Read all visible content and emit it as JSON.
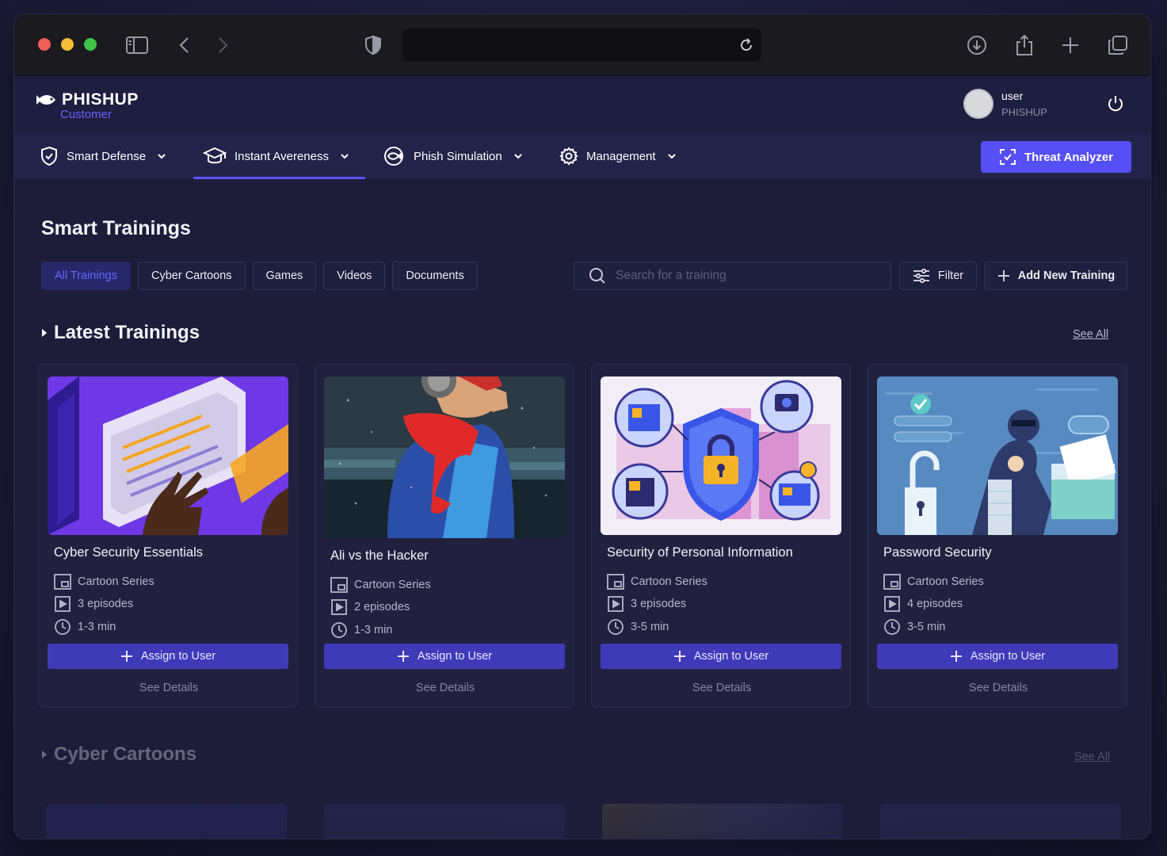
{
  "app": {
    "brand": "PHISHUP",
    "subtitle": "Customer"
  },
  "user": {
    "name": "user",
    "org": "PHISHUP"
  },
  "nav": {
    "items": [
      {
        "label": "Smart Defense",
        "icon": "shield-check-icon"
      },
      {
        "label": "Instant Avereness",
        "icon": "graduation-cap-icon",
        "active": true
      },
      {
        "label": "Phish Simulation",
        "icon": "fish-target-icon"
      },
      {
        "label": "Management",
        "icon": "gear-icon"
      }
    ],
    "threat_button": "Threat Analyzer"
  },
  "page": {
    "title": "Smart Trainings",
    "tabs": [
      {
        "label": "All Trainings",
        "active": true
      },
      {
        "label": "Cyber Cartoons"
      },
      {
        "label": "Games"
      },
      {
        "label": "Videos"
      },
      {
        "label": "Documents"
      }
    ],
    "search_placeholder": "Search for a training",
    "filter_label": "Filter",
    "add_label": "Add New Training"
  },
  "sections": [
    {
      "title": "Latest Trainings",
      "see_all": "See All",
      "cards": [
        {
          "title": "Cyber Security Essentials",
          "type": "Cartoon Series",
          "episodes": "3 episodes",
          "duration": "1-3 min",
          "assign": "Assign to User",
          "details": "See Details"
        },
        {
          "title": "Ali vs the Hacker",
          "type": "Cartoon Series",
          "episodes": "2 episodes",
          "duration": "1-3 min",
          "assign": "Assign to User",
          "details": "See Details"
        },
        {
          "title": "Security of Personal Information",
          "type": "Cartoon Series",
          "episodes": "3 episodes",
          "duration": "3-5 min",
          "assign": "Assign to User",
          "details": "See Details"
        },
        {
          "title": "Password Security",
          "type": "Cartoon Series",
          "episodes": "4 episodes",
          "duration": "3-5 min",
          "assign": "Assign to User",
          "details": "See Details"
        }
      ]
    },
    {
      "title": "Cyber Cartoons",
      "see_all": "See All"
    }
  ],
  "colors": {
    "accent": "#564ff5",
    "assign_button": "#3f3ab8",
    "active_tab_text": "#6a64ff",
    "background": "#1d1d3a"
  }
}
